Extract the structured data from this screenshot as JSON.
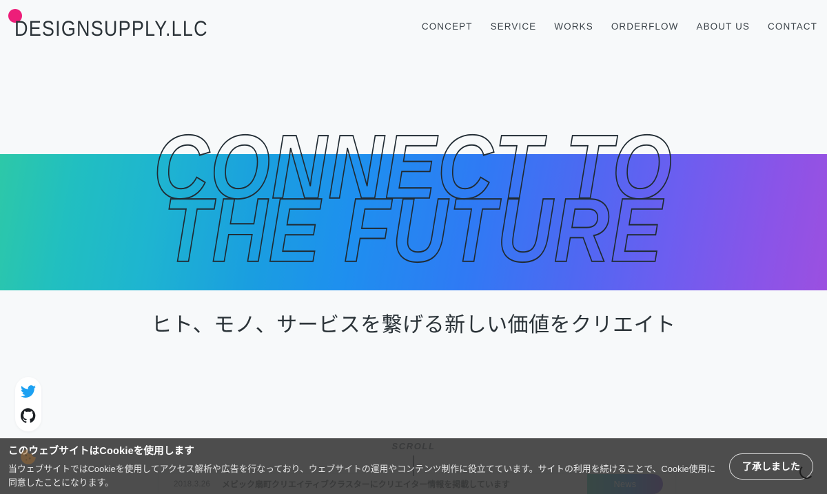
{
  "site": {
    "logo_text": "DESIGNSUPPLY.LLC",
    "logo_dot_color": "#ed1e79",
    "background_color": "#f7f9fa"
  },
  "nav": {
    "items": [
      {
        "label": "CONCEPT"
      },
      {
        "label": "SERVICE"
      },
      {
        "label": "WORKS"
      },
      {
        "label": "ORDERFLOW"
      },
      {
        "label": "ABOUT US"
      },
      {
        "label": "CONTACT"
      }
    ]
  },
  "hero": {
    "line1": "CONNECT TO",
    "line2": "THE FUTURE",
    "tagline": "ヒト、モノ、サービスを繋げる新しい価値をクリエイト",
    "gradient_start": "#2dc8a8",
    "gradient_mid": "#1e8fef",
    "gradient_end": "#9b50e0",
    "stroke_color": "#202b33"
  },
  "social": {
    "items": [
      {
        "name": "twitter",
        "color": "#1da1f2"
      },
      {
        "name": "github",
        "color": "#1b1f23"
      }
    ]
  },
  "scroll": {
    "label": "SCROLL"
  },
  "news": {
    "date": "2018.3.26",
    "headline": "メビック扇町クリエイティブクラスターにクリエイター情報を掲載しています",
    "badge_label": "News"
  },
  "cookie": {
    "title": "このウェブサイトはCookieを使用します",
    "body": "当ウェブサイトではCookieを使用してアクセス解析や広告を行なっており、ウェブサイトの運用やコンテンツ制作に役立てています。サイトの利用を続けることで、Cookie使用に同意したことになります。",
    "accept_label": "了承しました",
    "banner_color": "#3a3a3a"
  }
}
